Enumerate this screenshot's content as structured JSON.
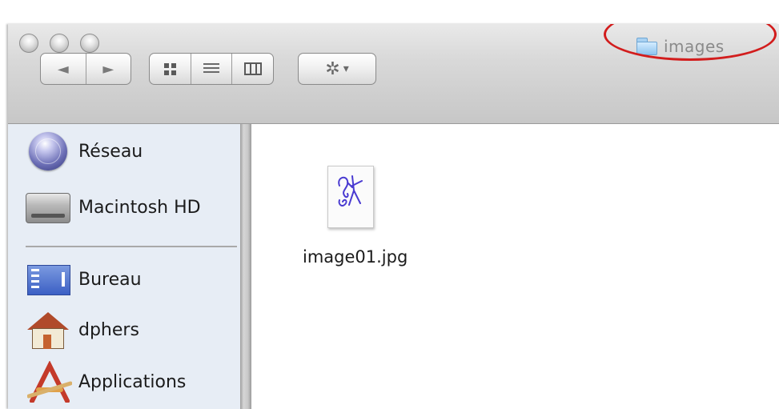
{
  "window": {
    "title": "images",
    "traffic_lights": [
      "close-button",
      "minimize-button",
      "zoom-button"
    ]
  },
  "toolbar": {
    "back_icon": "◄",
    "forward_icon": "►",
    "action_icon": "✲",
    "action_chevron": "▾"
  },
  "sidebar": {
    "items": [
      {
        "label": "Réseau",
        "icon": "network-globe-icon"
      },
      {
        "label": "Macintosh HD",
        "icon": "hard-drive-icon"
      },
      {
        "label": "Bureau",
        "icon": "desktop-icon"
      },
      {
        "label": "dphers",
        "icon": "home-icon"
      },
      {
        "label": "Applications",
        "icon": "applications-icon"
      }
    ]
  },
  "content": {
    "files": [
      {
        "name": "image01.jpg",
        "icon": "image-thumbnail-icon"
      }
    ]
  },
  "colors": {
    "annotation_ring": "#d21d1d",
    "sidebar_bg": "#e7edf5",
    "title_text": "#8a8a8a"
  }
}
